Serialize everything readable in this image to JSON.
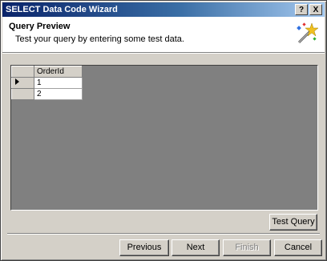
{
  "window": {
    "title": "SELECT Data Code Wizard",
    "help_button": "?",
    "close_button": "X"
  },
  "header": {
    "title": "Query Preview",
    "subtitle": "Test your query by entering some test data.",
    "icon": "wizard-wand-icon"
  },
  "grid": {
    "columns": [
      "OrderId"
    ],
    "rows": [
      {
        "selected": true,
        "values": [
          "1"
        ]
      },
      {
        "selected": false,
        "values": [
          "2"
        ]
      }
    ]
  },
  "buttons": {
    "test_query": "Test Query",
    "previous": "Previous",
    "next": "Next",
    "finish": "Finish",
    "cancel": "Cancel"
  },
  "colors": {
    "titlebar_start": "#0a246a",
    "titlebar_end": "#a6caf0",
    "dialog_bg": "#d4d0c8",
    "grid_bg": "#808080"
  }
}
